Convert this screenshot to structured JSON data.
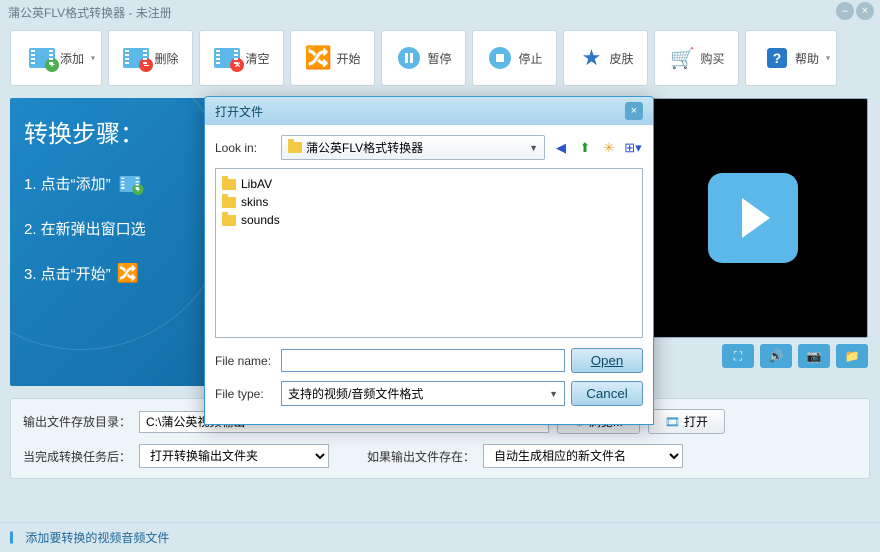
{
  "window": {
    "title": "蒲公英FLV格式转换器 - 未注册"
  },
  "toolbar": {
    "add": "添加",
    "delete": "删除",
    "clear": "清空",
    "start": "开始",
    "pause": "暂停",
    "stop": "停止",
    "skin": "皮肤",
    "buy": "购买",
    "help": "帮助"
  },
  "steps": {
    "title": "转换步骤：",
    "items": [
      "1. 点击“添加”",
      "2. 在新弹出窗口选",
      "3. 点击“开始”"
    ]
  },
  "output": {
    "dir_label": "输出文件存放目录：",
    "dir_value": "C:\\蒲公英视频输出",
    "browse": "浏览...",
    "open": "打开",
    "after_label": "当完成转换任务后：",
    "after_value": "打开转换输出文件夹",
    "exists_label": "如果输出文件存在：",
    "exists_value": "自动生成相应的新文件名"
  },
  "status": "添加要转换的视频音频文件",
  "dialog": {
    "title": "打开文件",
    "lookin_label": "Look in:",
    "lookin_value": "蒲公英FLV格式转换器",
    "files": [
      "LibAV",
      "skins",
      "sounds"
    ],
    "filename_label": "File name:",
    "filename_value": "",
    "filetype_label": "File type:",
    "filetype_value": "支持的视频/音频文件格式",
    "open": "Open",
    "cancel": "Cancel"
  }
}
